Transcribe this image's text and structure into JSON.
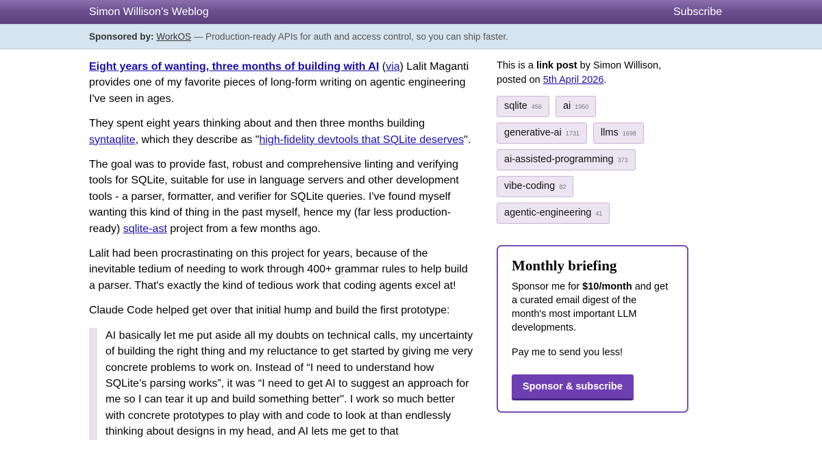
{
  "header": {
    "title": "Simon Willison’s Weblog",
    "subscribe": "Subscribe"
  },
  "sponsor": {
    "label": "Sponsored by:",
    "name": "WorkOS",
    "text": " — Production-ready APIs for auth and access control, so you can ship faster."
  },
  "post": {
    "link_text": "Eight years of wanting, three months of building with AI",
    "via": "via",
    "p1_rest": ") Lalit Maganti provides one of my favorite pieces of long-form writing on agentic engineering I've seen in ages.",
    "p2_a": "They spent eight years thinking about and then three months building ",
    "p2_link1": "syntaqlite",
    "p2_b": ", which they describe as \"",
    "p2_link2": "high-fidelity devtools that SQLite deserves",
    "p2_c": "\".",
    "p3_a": "The goal was to provide fast, robust and comprehensive linting and verifying tools for SQLite, suitable for use in language servers and other development tools - a parser, formatter, and verifier for SQLite queries. I've found myself wanting this kind of thing in the past myself, hence my (far less production-ready) ",
    "p3_link": "sqlite-ast",
    "p3_b": " project from a few months ago.",
    "p4": "Lalit had been procrastinating on this project for years, because of the inevitable tedium of needing to work through 400+ grammar rules to help build a parser. That's exactly the kind of tedious work that coding agents excel at!",
    "p5": "Claude Code helped get over that initial hump and build the first prototype:",
    "quote": "AI basically let me put aside all my doubts on technical calls, my uncertainty of building the right thing and my reluctance to get started by giving me very concrete problems to work on. Instead of “I need to understand how SQLite’s parsing works”, it was “I need to get AI to suggest an approach for me so I can tear it up and build something better\". I work so much better with concrete prototypes to play with and code to look at than endlessly thinking about designs in my head, and AI lets me get to that"
  },
  "sidebar": {
    "intro_a": "This is a ",
    "intro_bold": "link post",
    "intro_b": " by Simon Willison, posted on ",
    "date": "5th April 2026",
    "intro_c": ".",
    "tags": [
      {
        "name": "sqlite",
        "count": "456"
      },
      {
        "name": "ai",
        "count": "1950"
      },
      {
        "name": "generative-ai",
        "count": "1731"
      },
      {
        "name": "llms",
        "count": "1698"
      },
      {
        "name": "ai-assisted-programming",
        "count": "373"
      },
      {
        "name": "vibe-coding",
        "count": "82"
      },
      {
        "name": "agentic-engineering",
        "count": "41"
      }
    ],
    "briefing": {
      "title": "Monthly briefing",
      "text_a": "Sponsor me for ",
      "price": "$10/month",
      "text_b": " and get a curated email digest of the month's most important LLM developments.",
      "text2": "Pay me to send you less!",
      "button": "Sponsor & subscribe"
    }
  }
}
